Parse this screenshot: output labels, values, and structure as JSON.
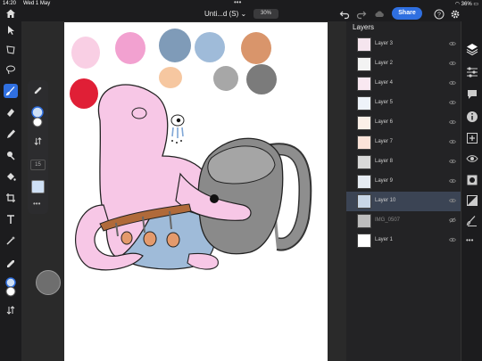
{
  "status": {
    "time": "14:20",
    "date": "Wed 1 May",
    "battery": "36%"
  },
  "topbar": {
    "title": "Unti...d (S)",
    "zoom": "30%",
    "share_label": "Share"
  },
  "tool_options": {
    "brush_size": "15"
  },
  "layers_panel": {
    "title": "Layers",
    "layers": [
      {
        "name": "Layer 3",
        "visible": true,
        "selected": false
      },
      {
        "name": "Layer 2",
        "visible": true,
        "selected": false
      },
      {
        "name": "Layer 4",
        "visible": true,
        "selected": false
      },
      {
        "name": "Layer 5",
        "visible": true,
        "selected": false
      },
      {
        "name": "Layer 6",
        "visible": true,
        "selected": false
      },
      {
        "name": "Layer 7",
        "visible": true,
        "selected": false
      },
      {
        "name": "Layer 8",
        "visible": true,
        "selected": false
      },
      {
        "name": "Layer 9",
        "visible": true,
        "selected": false
      },
      {
        "name": "Layer 10",
        "visible": true,
        "selected": true
      },
      {
        "name": "IMG_0507",
        "visible": false,
        "selected": false
      },
      {
        "name": "Layer 1",
        "visible": true,
        "selected": false
      }
    ]
  },
  "colors": {
    "accent": "#2f6fe0",
    "palette": [
      "#f9cfe4",
      "#f2a1d0",
      "#7f9bb8",
      "#9fbbd9",
      "#d9956b",
      "#e01f36",
      "#f6c7a0",
      "#a7a7a7",
      "#7b7b7b"
    ]
  }
}
